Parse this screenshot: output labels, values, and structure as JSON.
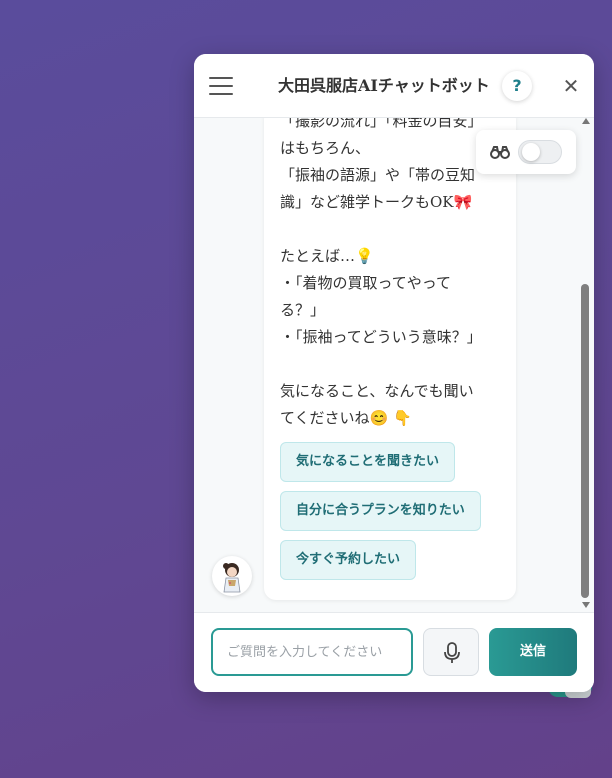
{
  "header": {
    "title": "大田呉服店AIチャットボット",
    "help_label": "?",
    "close_label": "✕"
  },
  "message": {
    "lines": [
      "「撮影の流れ」「料金の目安」",
      "はもちろん、",
      "「振袖の語源」や「帯の豆知",
      "識」など雑学トークもOK🎀",
      "",
      "たとえば…💡",
      "・「着物の買取ってやって",
      "る？」",
      "・「振袖ってどういう意味？」",
      "",
      "気になること、なんでも聞い",
      "てくださいね😊 👇"
    ]
  },
  "quick_replies": [
    {
      "label": "気になることを聞きたい"
    },
    {
      "label": "自分に合うプランを知りたい"
    },
    {
      "label": "今すぐ予約したい"
    }
  ],
  "input": {
    "placeholder": "ご質問を入力してください",
    "value": ""
  },
  "send_label": "送信",
  "toggle": {
    "on": false
  },
  "icons": {
    "menu": "hamburger-menu-icon",
    "help": "question-icon",
    "close": "close-icon",
    "binoculars": "binoculars-icon",
    "mic": "microphone-icon"
  },
  "colors": {
    "accent": "#2a9a94",
    "chip_bg": "#e6f6f7",
    "chip_text": "#1f6d75"
  }
}
